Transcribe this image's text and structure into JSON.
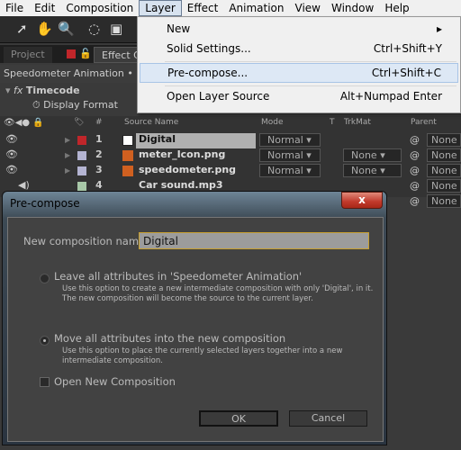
{
  "menubar": {
    "items": [
      "File",
      "Edit",
      "Composition",
      "Layer",
      "Effect",
      "Animation",
      "View",
      "Window",
      "Help"
    ]
  },
  "layer_menu": {
    "items": [
      {
        "label": "New",
        "shortcut": "",
        "submenu": true
      },
      {
        "label": "Solid Settings...",
        "shortcut": "Ctrl+Shift+Y"
      },
      {
        "label": "Pre-compose...",
        "shortcut": "Ctrl+Shift+C"
      },
      {
        "label": "Open Layer Source",
        "shortcut": "Alt+Numpad Enter"
      }
    ]
  },
  "panels": {
    "project_tab": "Project",
    "effect_tab": "Effect C",
    "breadcrumb": "Speedometer Animation • Di",
    "effect_name": "Timecode",
    "fx": "fx",
    "property": "Display Format"
  },
  "timeline": {
    "headers": {
      "num": "#",
      "source": "Source Name",
      "mode": "Mode",
      "t": "T",
      "trkmat": "TrkMat",
      "parent": "Parent"
    },
    "layers": [
      {
        "num": "1",
        "name": "Digital",
        "mode": "Normal",
        "trkmat": "",
        "parent": "None",
        "color": "#c0262a"
      },
      {
        "num": "2",
        "name": "meter_Icon.png",
        "mode": "Normal",
        "trkmat": "None",
        "parent": "None",
        "color": "#b4b4d2"
      },
      {
        "num": "3",
        "name": "speedometer.png",
        "mode": "Normal",
        "trkmat": "None",
        "parent": "None",
        "color": "#b4b4d2"
      },
      {
        "num": "4",
        "name": "Car sound.mp3",
        "parent": "None",
        "color": "#a8c8a8"
      },
      {
        "parent": "None"
      }
    ]
  },
  "dialog": {
    "title": "Pre-compose",
    "close": "x",
    "name_label": "New composition name:",
    "name_value": "Digital",
    "option1": {
      "label": "Leave all attributes in 'Speedometer Animation'",
      "desc1": "Use this option to create a new intermediate composition with only 'Digital', in it.",
      "desc2": "The new composition will become the source to the current layer.",
      "selected": false
    },
    "option2": {
      "label": "Move all attributes into the new composition",
      "desc1": "Use this option to place the currently selected layers together into a new",
      "desc2": "intermediate composition.",
      "selected": true
    },
    "open_new": {
      "label": "Open New Composition",
      "checked": false
    },
    "ok": "OK",
    "cancel": "Cancel"
  }
}
